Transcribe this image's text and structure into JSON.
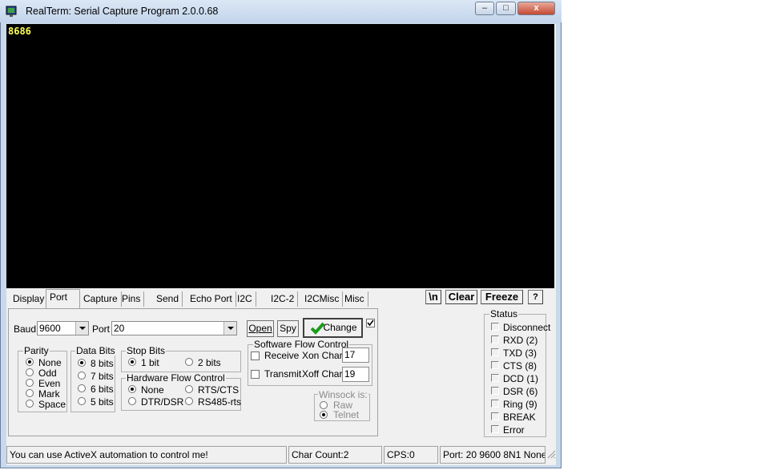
{
  "window": {
    "title": "RealTerm: Serial Capture Program 2.0.0.68",
    "controls": {
      "minimize": "–",
      "maximize": "□",
      "close": "x"
    }
  },
  "terminal": {
    "text": "8686",
    "text_color": "#ffff55",
    "background": "#000000"
  },
  "tabs": [
    "Display",
    "Port",
    "Capture",
    "Pins",
    "Send",
    "Echo Port",
    "I2C",
    "I2C-2",
    "I2CMisc",
    "Misc"
  ],
  "active_tab": "Port",
  "toolbar": {
    "newline": "\\n",
    "clear": "Clear",
    "freeze": "Freeze",
    "help": "?"
  },
  "port": {
    "baud_label": "Baud",
    "baud_value": "9600",
    "port_label": "Port",
    "port_value": "20",
    "open_button": "Open",
    "spy_button": "Spy",
    "change_button": "Change"
  },
  "parity": {
    "label": "Parity",
    "options": [
      "None",
      "Odd",
      "Even",
      "Mark",
      "Space"
    ],
    "selected": "None"
  },
  "data_bits": {
    "label": "Data Bits",
    "options": [
      "8 bits",
      "7 bits",
      "6 bits",
      "5 bits"
    ],
    "selected": "8 bits"
  },
  "stop_bits": {
    "label": "Stop Bits",
    "options": [
      "1 bit",
      "2 bits"
    ],
    "selected": "1 bit"
  },
  "hw_flow": {
    "label": "Hardware Flow Control",
    "options": [
      "None",
      "RTS/CTS",
      "DTR/DSR",
      "RS485-rts"
    ],
    "selected": "None"
  },
  "sw_flow": {
    "label": "Software Flow Control",
    "receive": "Receive",
    "transmit": "Transmit",
    "xon_label": "Xon Char:",
    "xon_value": "17",
    "xoff_label": "Xoff Char:",
    "xoff_value": "19"
  },
  "winsock": {
    "label": "Winsock is:",
    "options": [
      "Raw",
      "Telnet"
    ],
    "selected": "Telnet"
  },
  "status": {
    "label": "Status",
    "items": [
      "Disconnect",
      "RXD (2)",
      "TXD (3)",
      "CTS (8)",
      "DCD (1)",
      "DSR (6)",
      "Ring (9)",
      "BREAK",
      "Error"
    ]
  },
  "statusbar": {
    "message": "You can use ActiveX automation to control me!",
    "char_count": "Char Count:2",
    "cps": "CPS:0",
    "port_info": "Port: 20 9600 8N1 None"
  },
  "colors": {
    "change_check": "#1a9c1a",
    "window_frame": "#c9d9ec"
  }
}
